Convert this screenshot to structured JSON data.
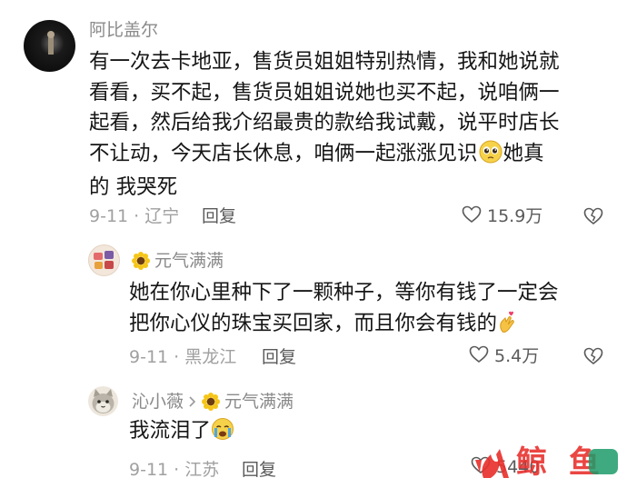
{
  "comments": [
    {
      "username": "阿比盖尔",
      "lines": [
        "有一次去卡地亚，售货员姐姐特别热情，我和她说就",
        "看看，买不起，售货员姐姐说她也买不起，说咱俩一",
        "起看，然后给我介绍最贵的款给我试戴，说平时店长",
        "不让动，今天店长休息，咱俩一起涨涨见识",
        "她真",
        "的 我哭死"
      ],
      "meta": "9-11 · 辽宁",
      "reply_label": "回复",
      "likes": "15.9万"
    },
    {
      "username": "元气满满",
      "lines": [
        "她在你心里种下了一颗种子，等你有钱了一定会",
        "把你心仪的珠宝买回家，而且你会有钱的"
      ],
      "meta": "9-11 · 黑龙江",
      "reply_label": "回复",
      "likes": "5.4万"
    },
    {
      "username": "沁小薇",
      "reply_to": "元气满满",
      "lines": [
        "我流泪了"
      ],
      "meta": "9-11 · 江苏",
      "reply_label": "回复",
      "likes": "5440"
    }
  ],
  "watermark": "鲸 鱼",
  "colors": {
    "text": "#161616",
    "secondary": "#8a8a8a",
    "meta": "#a0a0a0",
    "icon": "#5a5a5a",
    "watermark_red": "#e8322f",
    "watermark_green": "#1d9b6a"
  }
}
